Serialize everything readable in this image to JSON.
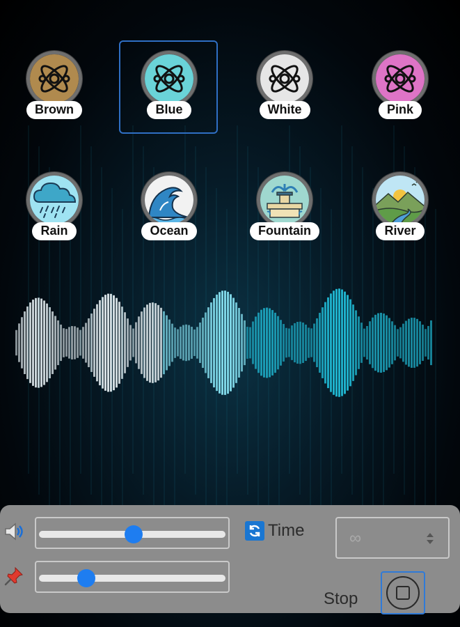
{
  "colors": {
    "brown": "#b08a4e",
    "blue": "#6ad3d8",
    "white": "#e6e6e6",
    "pink": "#de74c6",
    "accent": "#1e7df0",
    "panel": "#8c8c8c"
  },
  "sounds": [
    {
      "id": "brown",
      "label": "Brown",
      "icon": "atom-icon",
      "selected": false
    },
    {
      "id": "blue",
      "label": "Blue",
      "icon": "atom-icon",
      "selected": true
    },
    {
      "id": "white",
      "label": "White",
      "icon": "atom-icon",
      "selected": false
    },
    {
      "id": "pink",
      "label": "Pink",
      "icon": "atom-icon",
      "selected": false
    },
    {
      "id": "rain",
      "label": "Rain",
      "icon": "rain-cloud-icon",
      "selected": false
    },
    {
      "id": "ocean",
      "label": "Ocean",
      "icon": "wave-icon",
      "selected": false
    },
    {
      "id": "fountain",
      "label": "Fountain",
      "icon": "fountain-icon",
      "selected": false
    },
    {
      "id": "river",
      "label": "River",
      "icon": "river-landscape-icon",
      "selected": false
    }
  ],
  "controls": {
    "volume_icon": "speaker-icon",
    "volume_level": 0.5,
    "pin_icon": "pin-icon",
    "second_level": 0.25,
    "time_checked": true,
    "time_label": "Time",
    "duration_value": "∞",
    "stop_label": "Stop"
  }
}
